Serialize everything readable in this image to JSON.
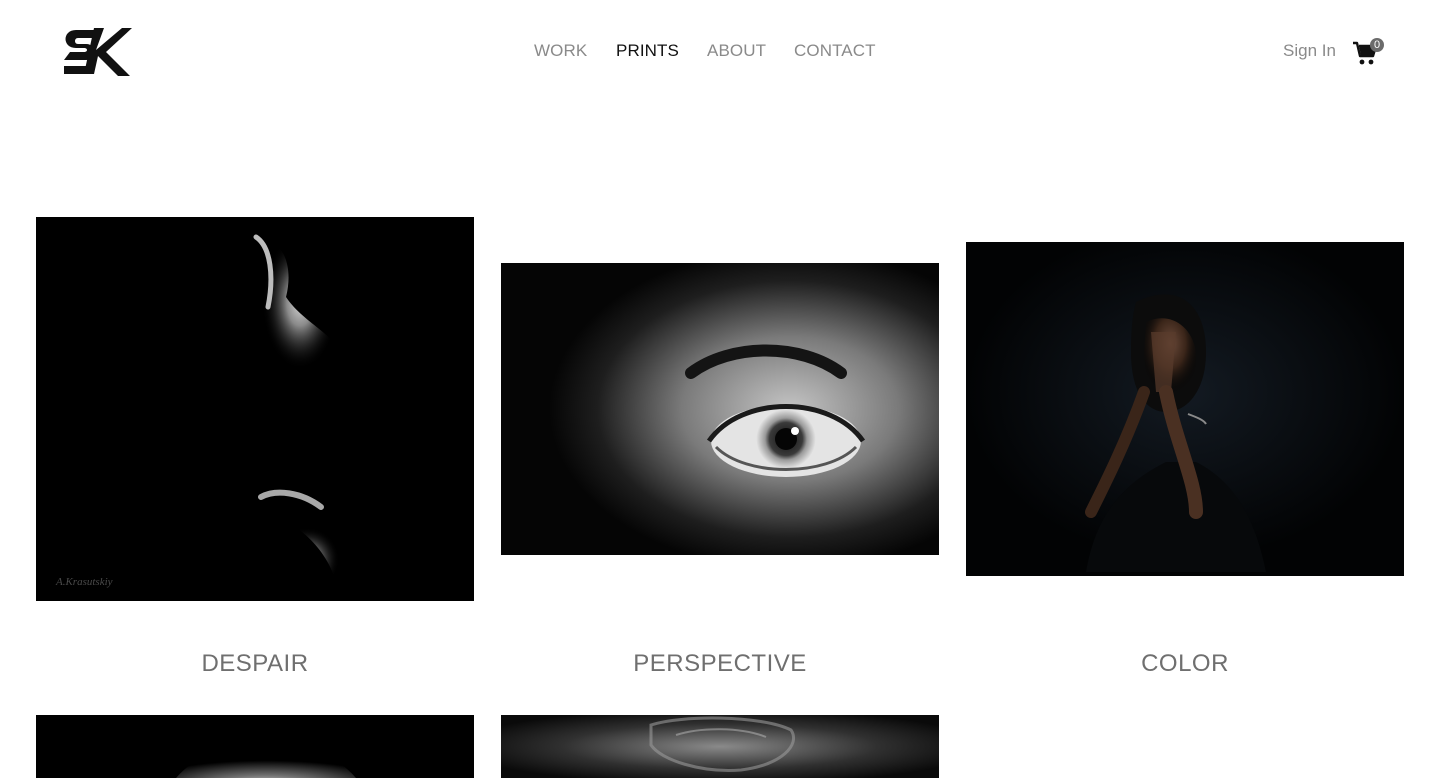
{
  "header": {
    "logo_text": "SK",
    "nav": [
      {
        "label": "WORK",
        "active": false
      },
      {
        "label": "PRINTS",
        "active": true
      },
      {
        "label": "ABOUT",
        "active": false
      },
      {
        "label": "CONTACT",
        "active": false
      }
    ],
    "sign_in_label": "Sign In",
    "cart_count": "0",
    "cart_icon": "cart-icon"
  },
  "gallery": {
    "items": [
      {
        "title": "DESPAIR",
        "watermark": "A.Krasutskiy",
        "tone": "dark"
      },
      {
        "title": "PERSPECTIVE",
        "tone": "grey"
      },
      {
        "title": "COLOR",
        "tone": "dark"
      },
      {
        "title": "",
        "tone": "dark"
      },
      {
        "title": "",
        "tone": "grey"
      }
    ]
  },
  "colors": {
    "nav_inactive": "#8a8a8a",
    "nav_active": "#111111",
    "title": "#6f6f6f",
    "background": "#ffffff"
  }
}
